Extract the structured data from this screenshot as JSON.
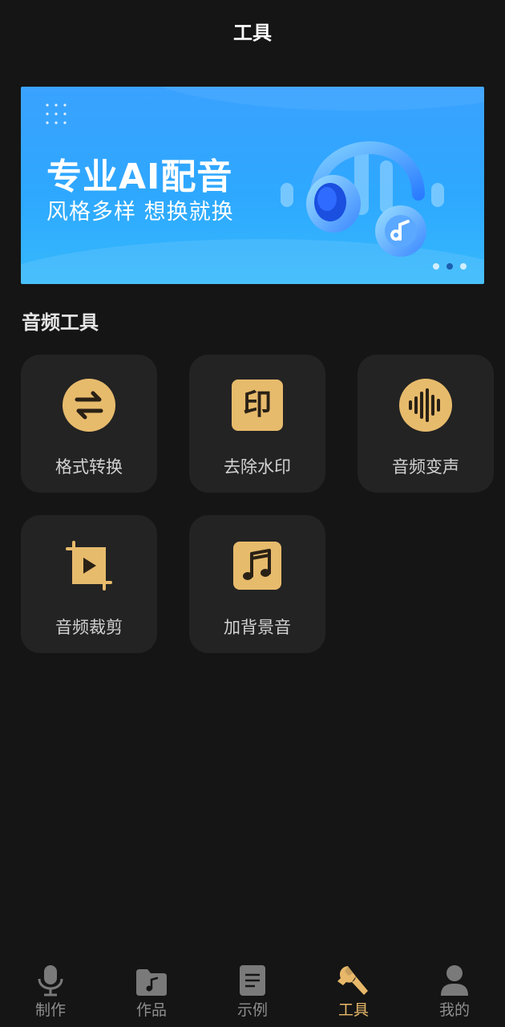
{
  "header": {
    "title": "工具"
  },
  "banner": {
    "title": "专业AI配音",
    "subtitle": "风格多样 想换就换",
    "pager": {
      "count": 3,
      "active_index": 1
    }
  },
  "section": {
    "title": "音频工具"
  },
  "tools": [
    {
      "label": "格式转换",
      "icon": "swap-arrows-icon"
    },
    {
      "label": "去除水印",
      "icon": "stamp-yin-icon",
      "icon_text": "印"
    },
    {
      "label": "音频变声",
      "icon": "sound-wave-icon"
    },
    {
      "label": "音频裁剪",
      "icon": "crop-play-icon"
    },
    {
      "label": "加背景音",
      "icon": "music-note-icon"
    }
  ],
  "nav": {
    "items": [
      {
        "label": "制作",
        "icon": "microphone-icon",
        "active": false
      },
      {
        "label": "作品",
        "icon": "music-folder-icon",
        "active": false
      },
      {
        "label": "示例",
        "icon": "document-icon",
        "active": false
      },
      {
        "label": "工具",
        "icon": "wrench-icon",
        "active": true
      },
      {
        "label": "我的",
        "icon": "user-icon",
        "active": false
      }
    ]
  },
  "colors": {
    "background": "#151515",
    "card": "#232323",
    "accent": "#e8b86a",
    "icon_gold": "#e7bb6c",
    "icon_dark": "#2a2116",
    "nav_inactive": "#8e8e8e",
    "banner_blue": "#3aa2ff"
  }
}
